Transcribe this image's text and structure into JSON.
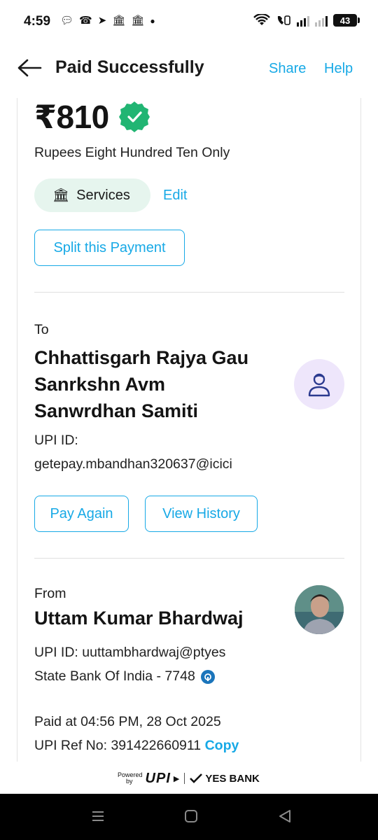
{
  "status_bar": {
    "time": "4:59",
    "battery": "43",
    "notification_icons": [
      "chat-icon",
      "missed-call-icon",
      "telegram-icon",
      "sbi-app-icon",
      "sbi-app-icon",
      "dot-icon"
    ],
    "system_icons": [
      "wifi-icon",
      "volte-icon",
      "signal-icon",
      "signal-icon",
      "battery-icon"
    ]
  },
  "header": {
    "title": "Paid Successfully",
    "share_label": "Share",
    "help_label": "Help"
  },
  "payment": {
    "amount": "₹810",
    "amount_words": "Rupees Eight Hundred Ten Only",
    "category": "Services",
    "edit_label": "Edit",
    "split_label": "Split this Payment"
  },
  "to": {
    "label": "To",
    "name": "Chhattisgarh Rajya Gau Sanrkshn Avm Sanwrdhan Samiti",
    "upi_label": "UPI ID:",
    "upi_id": "getepay.mbandhan320637@icici",
    "pay_again_label": "Pay Again",
    "view_history_label": "View History"
  },
  "from": {
    "label": "From",
    "name": "Uttam Kumar Bhardwaj",
    "upi_line": "UPI ID: uuttambhardwaj@ptyes",
    "bank_line": "State Bank Of India - 7748",
    "paid_at": "Paid at 04:56 PM, 28 Oct 2025",
    "ref_text": "UPI Ref No: 391422660911",
    "copy_label": "Copy"
  },
  "footer": {
    "powered": "Powered",
    "by": "by",
    "upi": "UPI",
    "bank": "YES BANK"
  },
  "colors": {
    "accent": "#17a9e6",
    "verified_green": "#21b573",
    "chip_bg": "#e6f5ee",
    "avatar_bg": "#eee6fb"
  }
}
